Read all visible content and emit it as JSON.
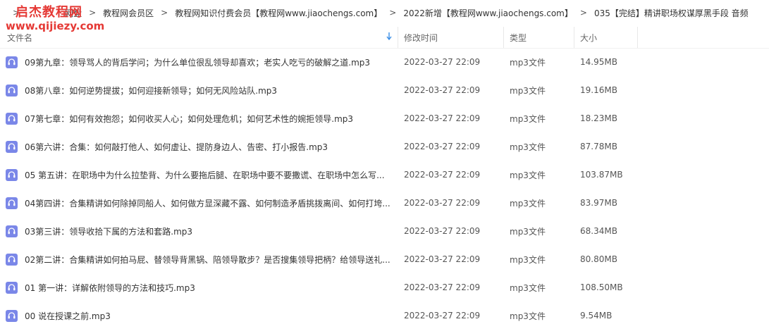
{
  "watermark": {
    "title": "启杰教程网",
    "url": "www.qijiezy.com"
  },
  "breadcrumb": {
    "items": [
      "网盘",
      "教程网会员区",
      "教程网知识付费会员【教程网www.jiaochengs.com】",
      "2022新增【教程网www.jiaochengs.com】",
      "035【完结】精讲职场权谋厚黑手段 音频"
    ]
  },
  "header": {
    "name": "文件名",
    "time": "修改时间",
    "type": "类型",
    "size": "大小",
    "sort_icon": "arrow-down-icon"
  },
  "accent_color": "#3a8ee6",
  "file_icon": {
    "name": "headphones-icon",
    "color": "#7a87e8"
  },
  "files": [
    {
      "name": "09第九章：领导骂人的背后学问；为什么单位很乱领导却喜欢；老实人吃亏的破解之道.mp3",
      "time": "2022-03-27 22:09",
      "type": "mp3文件",
      "size": "14.95MB"
    },
    {
      "name": "08第八章：如何逆势提拔；如何迎接新领导；如何无风险站队.mp3",
      "time": "2022-03-27 22:09",
      "type": "mp3文件",
      "size": "19.16MB"
    },
    {
      "name": "07第七章：如何有效抱怨；如何收买人心；如何处理危机；如何艺术性的婉拒领导.mp3",
      "time": "2022-03-27 22:09",
      "type": "mp3文件",
      "size": "18.23MB"
    },
    {
      "name": "06第六讲：合集：如何敲打他人、如何虚让、提防身边人、告密、打小报告.mp3",
      "time": "2022-03-27 22:09",
      "type": "mp3文件",
      "size": "87.78MB"
    },
    {
      "name": "05 第五讲：在职场中为什么拉垫背、为什么要拖后腿、在职场中要不要撒谎、在职场中怎么写...",
      "time": "2022-03-27 22:09",
      "type": "mp3文件",
      "size": "103.87MB"
    },
    {
      "name": "04第四讲：合集精讲如何除掉同船人、如何做方显深藏不露、如何制造矛盾挑拨离间、如何打垮...",
      "time": "2022-03-27 22:09",
      "type": "mp3文件",
      "size": "83.97MB"
    },
    {
      "name": "03第三讲：领导收拾下属的方法和套路.mp3",
      "time": "2022-03-27 22:09",
      "type": "mp3文件",
      "size": "68.34MB"
    },
    {
      "name": "02第二讲：合集精讲如何拍马屁、替领导背黑锅、陪领导散步？是否搜集领导把柄？给领导送礼...",
      "time": "2022-03-27 22:09",
      "type": "mp3文件",
      "size": "80.80MB"
    },
    {
      "name": "01 第一讲：详解依附领导的方法和技巧.mp3",
      "time": "2022-03-27 22:09",
      "type": "mp3文件",
      "size": "108.50MB"
    },
    {
      "name": "00 说在授课之前.mp3",
      "time": "2022-03-27 22:09",
      "type": "mp3文件",
      "size": "9.54MB"
    }
  ]
}
